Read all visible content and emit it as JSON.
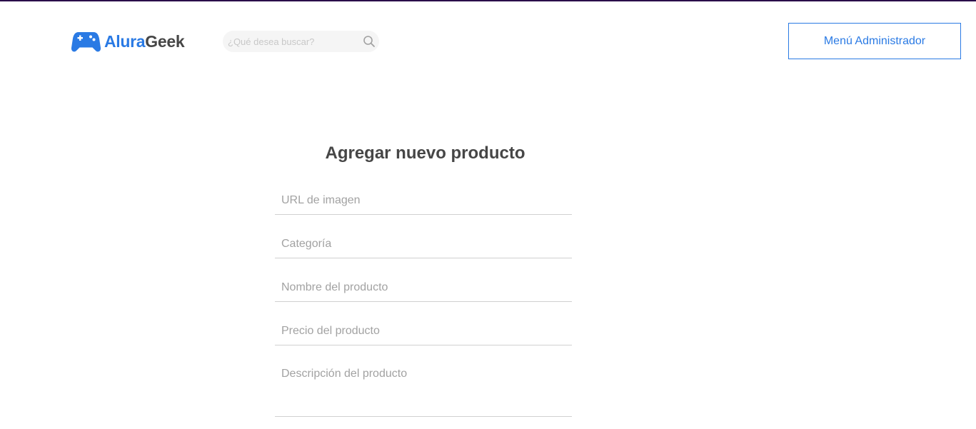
{
  "brand": {
    "name_part1": "Alura",
    "name_part2": "Geek",
    "primary_color": "#2a7ae4",
    "text_color": "#464646",
    "logo_icon": "gamepad-icon"
  },
  "search": {
    "placeholder": "¿Qué desea buscar?",
    "icon": "search-icon"
  },
  "header": {
    "admin_button_label": "Menú Administrador"
  },
  "form": {
    "title": "Agregar nuevo producto",
    "fields": {
      "image_url_placeholder": "URL de imagen",
      "category_placeholder": "Categoría",
      "name_placeholder": "Nombre del producto",
      "price_placeholder": "Precio del producto",
      "description_placeholder": "Descripción del producto"
    }
  }
}
